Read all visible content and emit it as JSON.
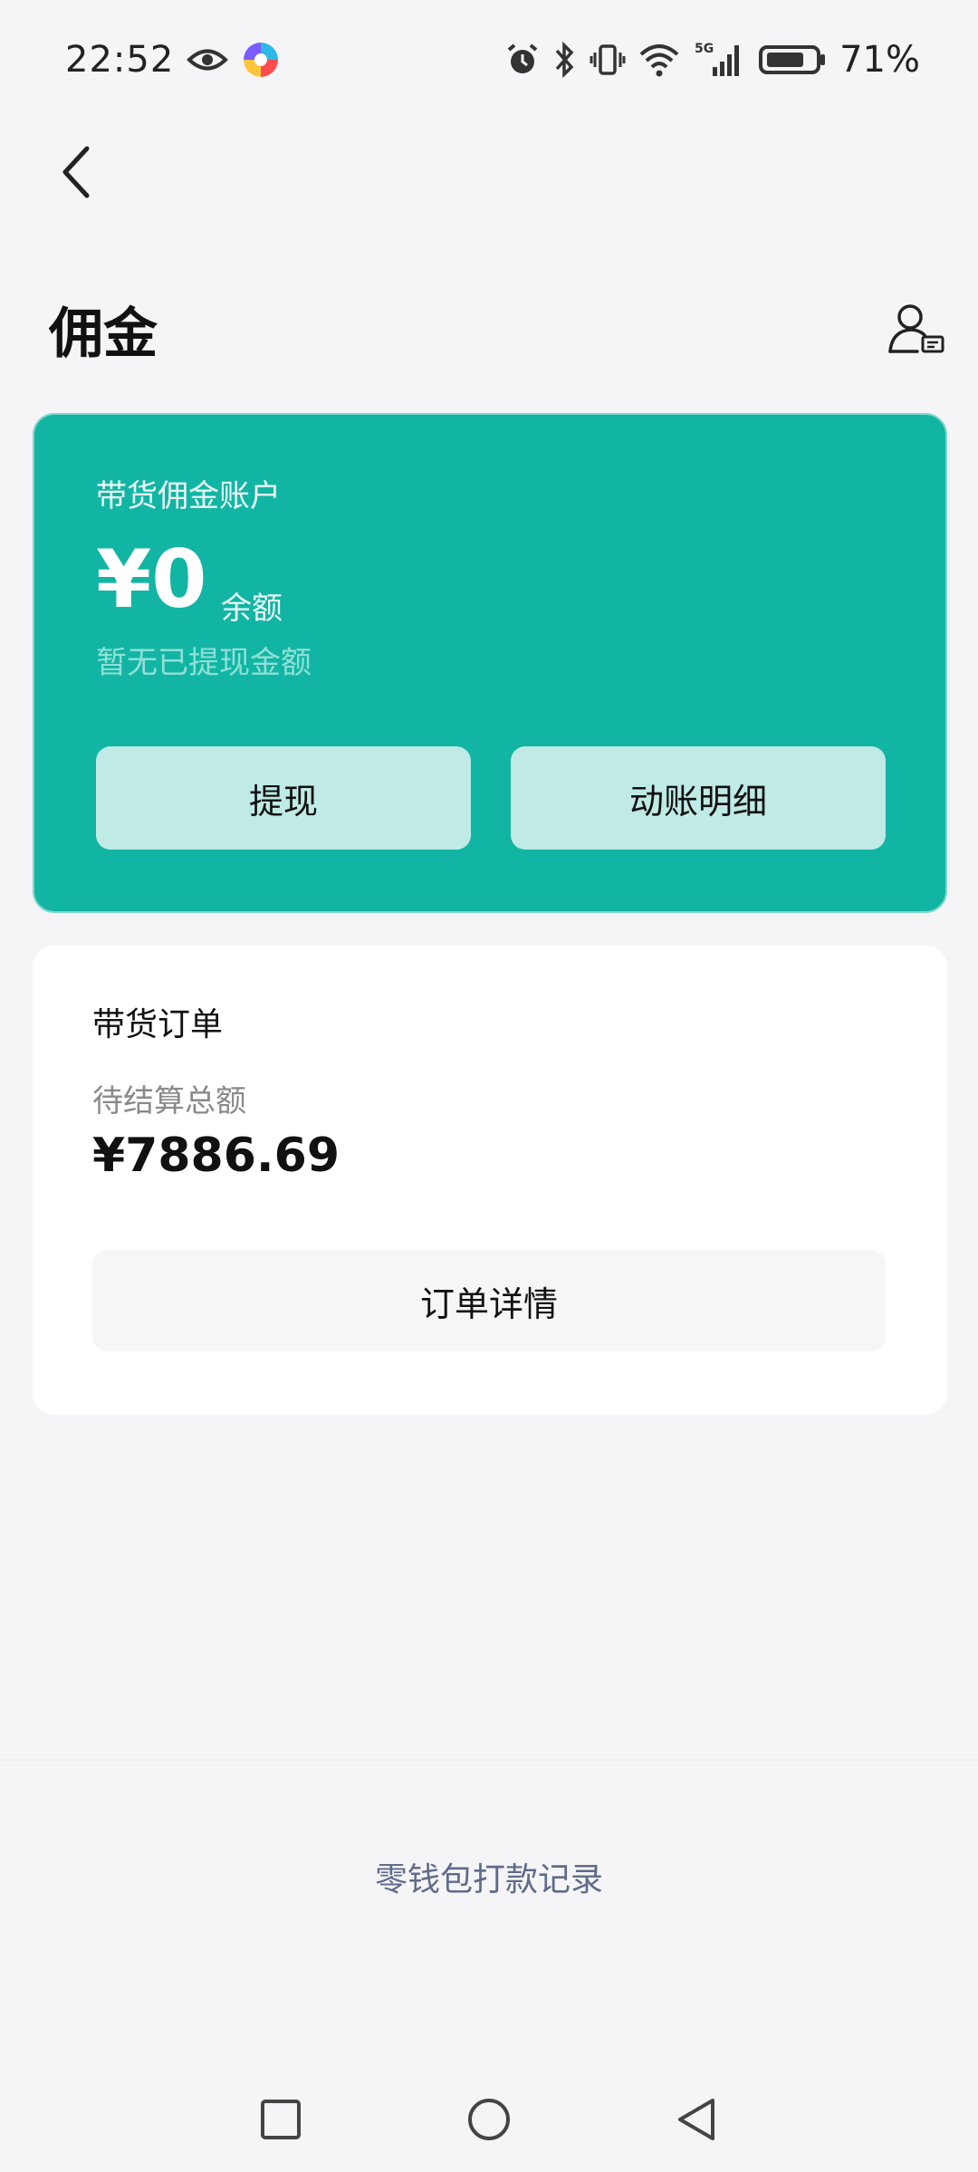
{
  "status_bar": {
    "time": "22:52",
    "battery_percent": "71%",
    "network": "5G",
    "icons": [
      "eye-icon",
      "app-logo-icon",
      "alarm-icon",
      "bluetooth-icon",
      "vibrate-icon",
      "wifi-icon",
      "signal-icon",
      "battery-icon"
    ]
  },
  "header": {
    "title": "佣金",
    "back_icon": "chevron-left-icon",
    "account_icon": "user-card-icon"
  },
  "commission_account": {
    "label": "带货佣金账户",
    "amount": "¥0",
    "amount_suffix": "余额",
    "subtext": "暂无已提现金额",
    "withdraw_label": "提现",
    "details_label": "动账明细",
    "accent_color": "#12b5a4"
  },
  "orders": {
    "title": "带货订单",
    "pending_label": "待结算总额",
    "pending_amount": "¥7886.69",
    "details_button_label": "订单详情"
  },
  "wallet_record_link": "零钱包打款记录",
  "nav_bar": {
    "recent_icon": "square-icon",
    "home_icon": "circle-icon",
    "back_icon": "triangle-back-icon"
  }
}
